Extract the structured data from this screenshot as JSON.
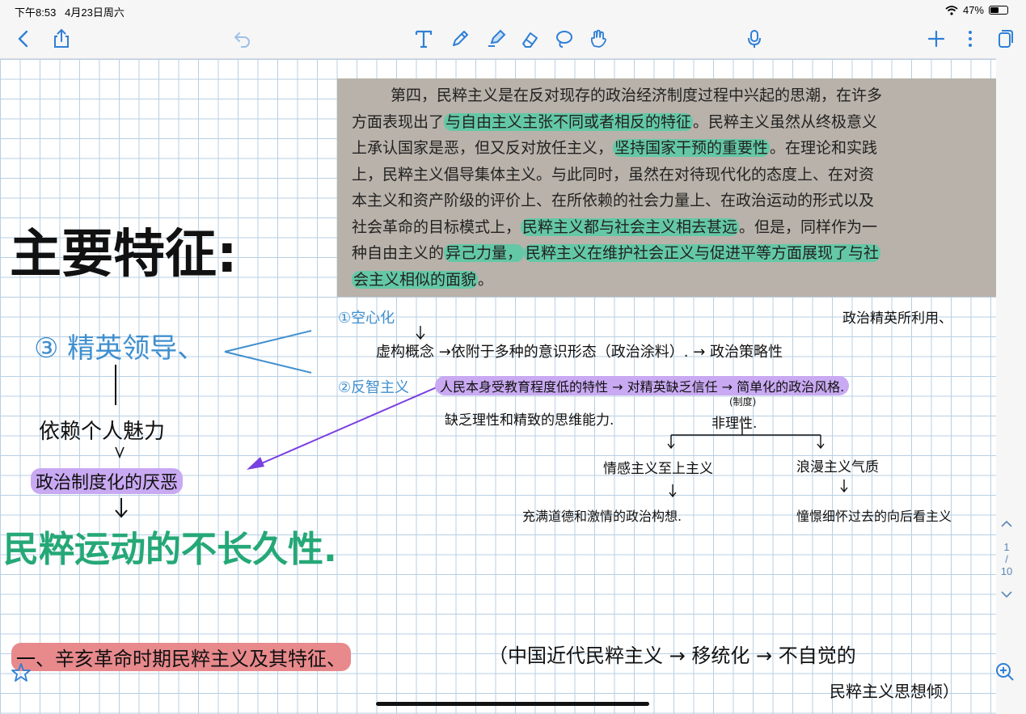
{
  "status": {
    "time": "下午8:53",
    "date": "4月23日周六",
    "battery": "47%"
  },
  "toolbar": {
    "left": [
      "back-icon",
      "share-icon",
      "undo-icon"
    ],
    "tools": [
      "text-tool-icon",
      "pen-icon",
      "highlighter-icon",
      "eraser-icon",
      "lasso-icon",
      "hand-tool-icon",
      "microphone-icon"
    ],
    "right": [
      "add-icon",
      "more-icon",
      "pages-icon"
    ]
  },
  "photo": {
    "lines": [
      {
        "parts": [
          {
            "t": "第四，民粹主义是在反对现存的政治经济制度过程中兴起的思潮，在许多"
          }
        ]
      },
      {
        "parts": [
          {
            "t": "方面表现出了"
          },
          {
            "t": "与自由主义主张不同或者相反的特征",
            "hl": true
          },
          {
            "t": "。民粹主义虽然从终极意义"
          }
        ]
      },
      {
        "parts": [
          {
            "t": "上承认国家是恶，但又反对放任主义，"
          },
          {
            "t": "坚持国家干预的重要性",
            "hl": true
          },
          {
            "t": "。在理论和实践"
          }
        ]
      },
      {
        "parts": [
          {
            "t": "上，民粹主义倡导集体主义。与此同时，虽然在对待现代化的态度上、在对资"
          }
        ]
      },
      {
        "parts": [
          {
            "t": "本主义和资产阶级的评价上、在所依赖的社会力量上、在政治运动的形式以及"
          }
        ]
      },
      {
        "parts": [
          {
            "t": "社会革命的目标模式上，"
          },
          {
            "t": "民粹主义都与社会主义相去甚远",
            "hl": true
          },
          {
            "t": "。但是，同样作为一"
          }
        ]
      },
      {
        "parts": [
          {
            "t": "种自由主义的"
          },
          {
            "t": "异己力量，",
            "hl": true
          },
          {
            "t": "民粹主义在维护社会正义与促进平等方面展现了与社",
            "hl": true
          }
        ]
      },
      {
        "parts": [
          {
            "t": "会主义相似的面貌",
            "hl": true
          },
          {
            "t": "。"
          }
        ]
      }
    ]
  },
  "notes": {
    "main_title": "主要特征:",
    "point3": "③ 精英领导、",
    "rely": "依赖个人魅力",
    "disgust": "政治制度化的厌恶",
    "conclusion": "民粹运动的不长久性.",
    "b1_label": "①空心化",
    "b1_text": "虚构概念 →依附于多种的意识形态（政治涂料）. → 政治策略性",
    "b1_top": "政治精英所利用、",
    "b2_label": "②反智主义",
    "b2_text": "人民本身受教育程度低的特性 → 对精英缺乏信任 → 简单化的政治风格.",
    "b2_sub": "缺乏理性和精致的思维能力.",
    "b2_note": "(制度)",
    "irrational": "非理性.",
    "emotional": "情感主义至上主义",
    "romantic": "浪漫主义气质",
    "moral": "充满道德和激情的政治构想.",
    "yearning": "憧憬细怀过去的向后看主义",
    "footer1": "一、辛亥革命时期民粹主义及其特征、",
    "footer2": "（中国近代民粹主义 → 移统化 → 不自觉的",
    "footer3": "民粹主义思想倾）"
  },
  "pager": {
    "current": "1",
    "sep": "/",
    "total": "10"
  },
  "colors": {
    "ink": "#111111",
    "blue": "#3f8fcf",
    "teal": "#25a877",
    "purple_arrow": "#7a3fe0",
    "highlight_teal": "#64c8a6",
    "highlight_purple": "#c9a9f2",
    "highlight_pink": "#e8898c"
  }
}
